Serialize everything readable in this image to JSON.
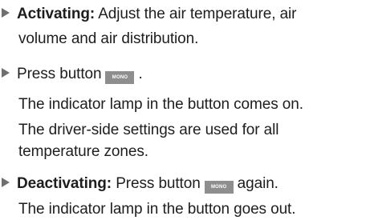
{
  "items": [
    {
      "lead": "Activating:",
      "text": " Adjust the air temperature, air",
      "cont": "volume and air distribution."
    },
    {
      "text_before": "Press button",
      "button": "MONO",
      "text_after": ".",
      "result_1": "The indicator lamp in the button comes on.",
      "result_2a": "The driver-side settings are used for all",
      "result_2b": "temperature zones."
    },
    {
      "lead": "Deactivating:",
      "text_before": " Press button",
      "button": "MONO",
      "text_after": "again.",
      "result": "The indicator lamp in the button goes out."
    }
  ]
}
